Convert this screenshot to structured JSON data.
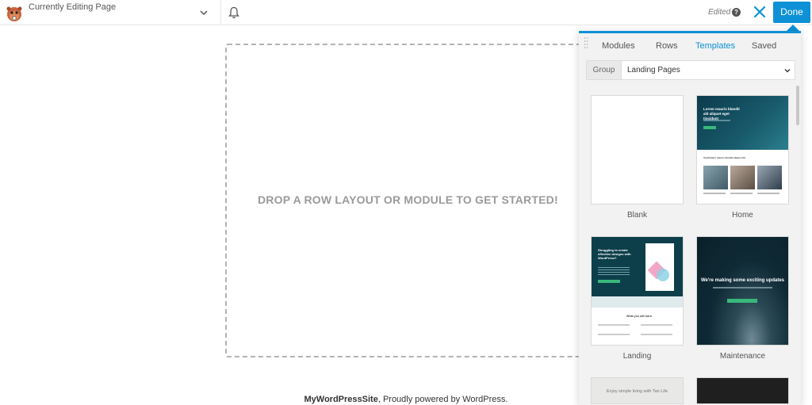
{
  "topbar": {
    "page_title": "Currently Editing Page",
    "edited_label": "Edited",
    "help_glyph": "?",
    "done_label": "Done",
    "icons": [
      "beaver-logo-icon",
      "chevron-down-icon",
      "bell-icon",
      "help-icon",
      "close-icon"
    ]
  },
  "canvas": {
    "drop_prompt": "DROP A ROW LAYOUT OR MODULE TO GET STARTED!",
    "footer_site": "MyWordPressSite",
    "footer_rest": ", Proudly powered by WordPress."
  },
  "panel": {
    "tabs": [
      {
        "label": "Modules",
        "active": false
      },
      {
        "label": "Rows",
        "active": false
      },
      {
        "label": "Templates",
        "active": true
      },
      {
        "label": "Saved",
        "active": false
      }
    ],
    "group_label": "Group",
    "group_value": "Landing Pages",
    "templates": [
      {
        "label": "Blank"
      },
      {
        "label": "Home",
        "thumb_text": "Lorem mauris blandit alit aliquet eget tincidunt",
        "thumb_sub": "Vestibulum mauris blandit aliquet elit"
      },
      {
        "label": "Landing",
        "thumb_text": "Struggling to create effective designs with WordPress?",
        "thumb_mid": "What you will learn"
      },
      {
        "label": "Maintenance",
        "thumb_text": "We're making some exciting updates"
      }
    ],
    "partial_thumb_text": "Enjoy simple living with Tan Life"
  },
  "colors": {
    "accent": "#0e91d6",
    "green": "#39b87b",
    "dark_teal": "#0d3f4a"
  }
}
